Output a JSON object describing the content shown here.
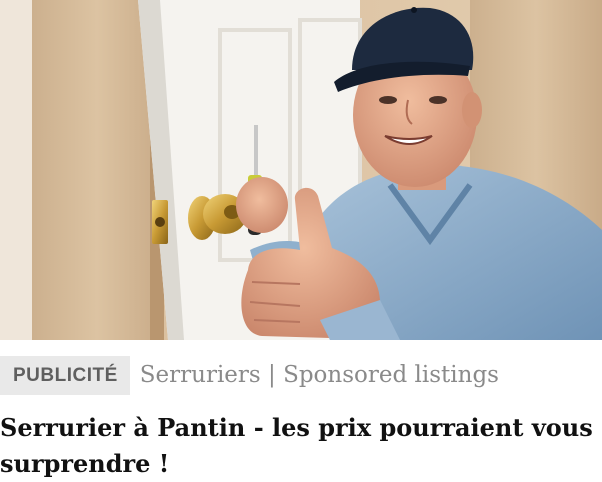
{
  "ad": {
    "badge_label": "PUBLICITÉ",
    "source_label": "Serruriers | Sponsored listings",
    "headline": "Serrurier à Pantin - les prix pourraient vous surprendre !",
    "image_subject": "locksmith-thumbs-up-photo"
  },
  "colors": {
    "badge_bg": "#e9e9e9",
    "badge_text": "#5f5f5f",
    "source_text": "#8a8a8a",
    "headline_text": "#111111"
  }
}
